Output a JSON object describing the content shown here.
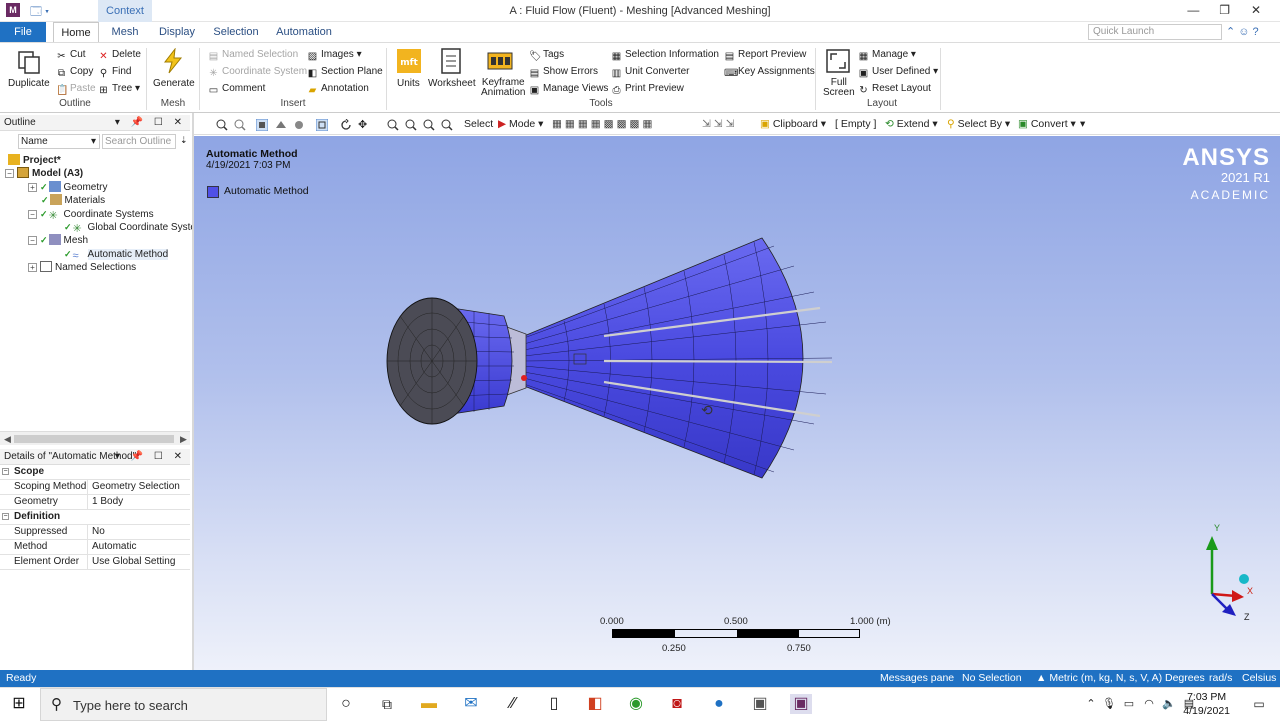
{
  "titlebar": {
    "context_tab": "Context",
    "title": "A : Fluid Flow (Fluent) - Meshing [Advanced Meshing]",
    "minimize": "—",
    "restore": "❐",
    "close": "✕"
  },
  "tabs": [
    "File",
    "Home",
    "Mesh",
    "Display",
    "Selection",
    "Automation"
  ],
  "quick_launch_placeholder": "Quick Launch",
  "ribbon": {
    "outline": {
      "duplicate": "Duplicate",
      "cut": "Cut",
      "copy": "Copy",
      "paste": "Paste",
      "delete": "Delete",
      "find": "Find",
      "tree": "Tree",
      "group": "Outline"
    },
    "mesh": {
      "generate": "Generate",
      "group": "Mesh"
    },
    "insert": {
      "named_selection": "Named Selection",
      "coordinate_system": "Coordinate System",
      "comment": "Comment",
      "images": "Images",
      "section_plane": "Section Plane",
      "annotation": "Annotation",
      "group": "Insert"
    },
    "tools": {
      "units": "Units",
      "worksheet": "Worksheet",
      "keyframe": "Keyframe",
      "animation": "Animation",
      "tags": "Tags",
      "show_errors": "Show Errors",
      "manage_views": "Manage Views",
      "selection_information": "Selection Information",
      "unit_converter": "Unit Converter",
      "print_preview": "Print Preview",
      "report_preview": "Report Preview",
      "key_assignments": "Key Assignments",
      "group": "Tools"
    },
    "layout": {
      "full": "Full",
      "screen": "Screen",
      "manage": "Manage",
      "user_defined": "User Defined",
      "reset_layout": "Reset Layout",
      "group": "Layout"
    }
  },
  "outline": {
    "title": "Outline",
    "name_filter": "Name",
    "search_placeholder": "Search Outline",
    "tree": [
      {
        "label": "Project*"
      },
      {
        "label": "Model (A3)"
      },
      {
        "label": "Geometry"
      },
      {
        "label": "Materials"
      },
      {
        "label": "Coordinate Systems"
      },
      {
        "label": "Global Coordinate System"
      },
      {
        "label": "Mesh"
      },
      {
        "label": "Automatic Method"
      },
      {
        "label": "Named Selections"
      }
    ]
  },
  "details": {
    "title": "Details of \"Automatic Method\"",
    "sections": [
      {
        "name": "Scope",
        "rows": [
          {
            "key": "Scoping Method",
            "value": "Geometry Selection"
          },
          {
            "key": "Geometry",
            "value": "1 Body"
          }
        ]
      },
      {
        "name": "Definition",
        "rows": [
          {
            "key": "Suppressed",
            "value": "No"
          },
          {
            "key": "Method",
            "value": "Automatic"
          },
          {
            "key": "Element Order",
            "value": "Use Global Setting"
          }
        ]
      }
    ]
  },
  "graphics_toolbar": {
    "select": "Select",
    "mode": "Mode",
    "clipboard": "Clipboard",
    "empty": "[ Empty ]",
    "extend": "Extend",
    "select_by": "Select By",
    "convert": "Convert"
  },
  "viewport": {
    "title": "Automatic Method",
    "date": "4/19/2021 7:03 PM",
    "legend_label": "Automatic Method",
    "legend_color": "#5050e6",
    "logo_line1": "ANSYS",
    "logo_line2": "2021 R1",
    "logo_line3": "ACADEMIC",
    "scale_top": [
      "0.000",
      "0.500",
      "1.000 (m)"
    ],
    "scale_bottom": [
      "0.250",
      "0.750"
    ],
    "triad": {
      "y": "Y",
      "x": "X",
      "z": "Z"
    }
  },
  "statusbar": {
    "ready": "Ready",
    "messages": "Messages pane",
    "selection": "No Selection",
    "units": "Metric (m, kg, N, s, V, A)",
    "degrees": "Degrees",
    "rads": "rad/s",
    "temp": "Celsius"
  },
  "taskbar": {
    "search": "Type here to search",
    "time": "7:03 PM",
    "date": "4/19/2021"
  },
  "colors": {
    "accent": "#1f71c3",
    "mesh": "#4a4ae0",
    "brand": "#6a2a63"
  }
}
